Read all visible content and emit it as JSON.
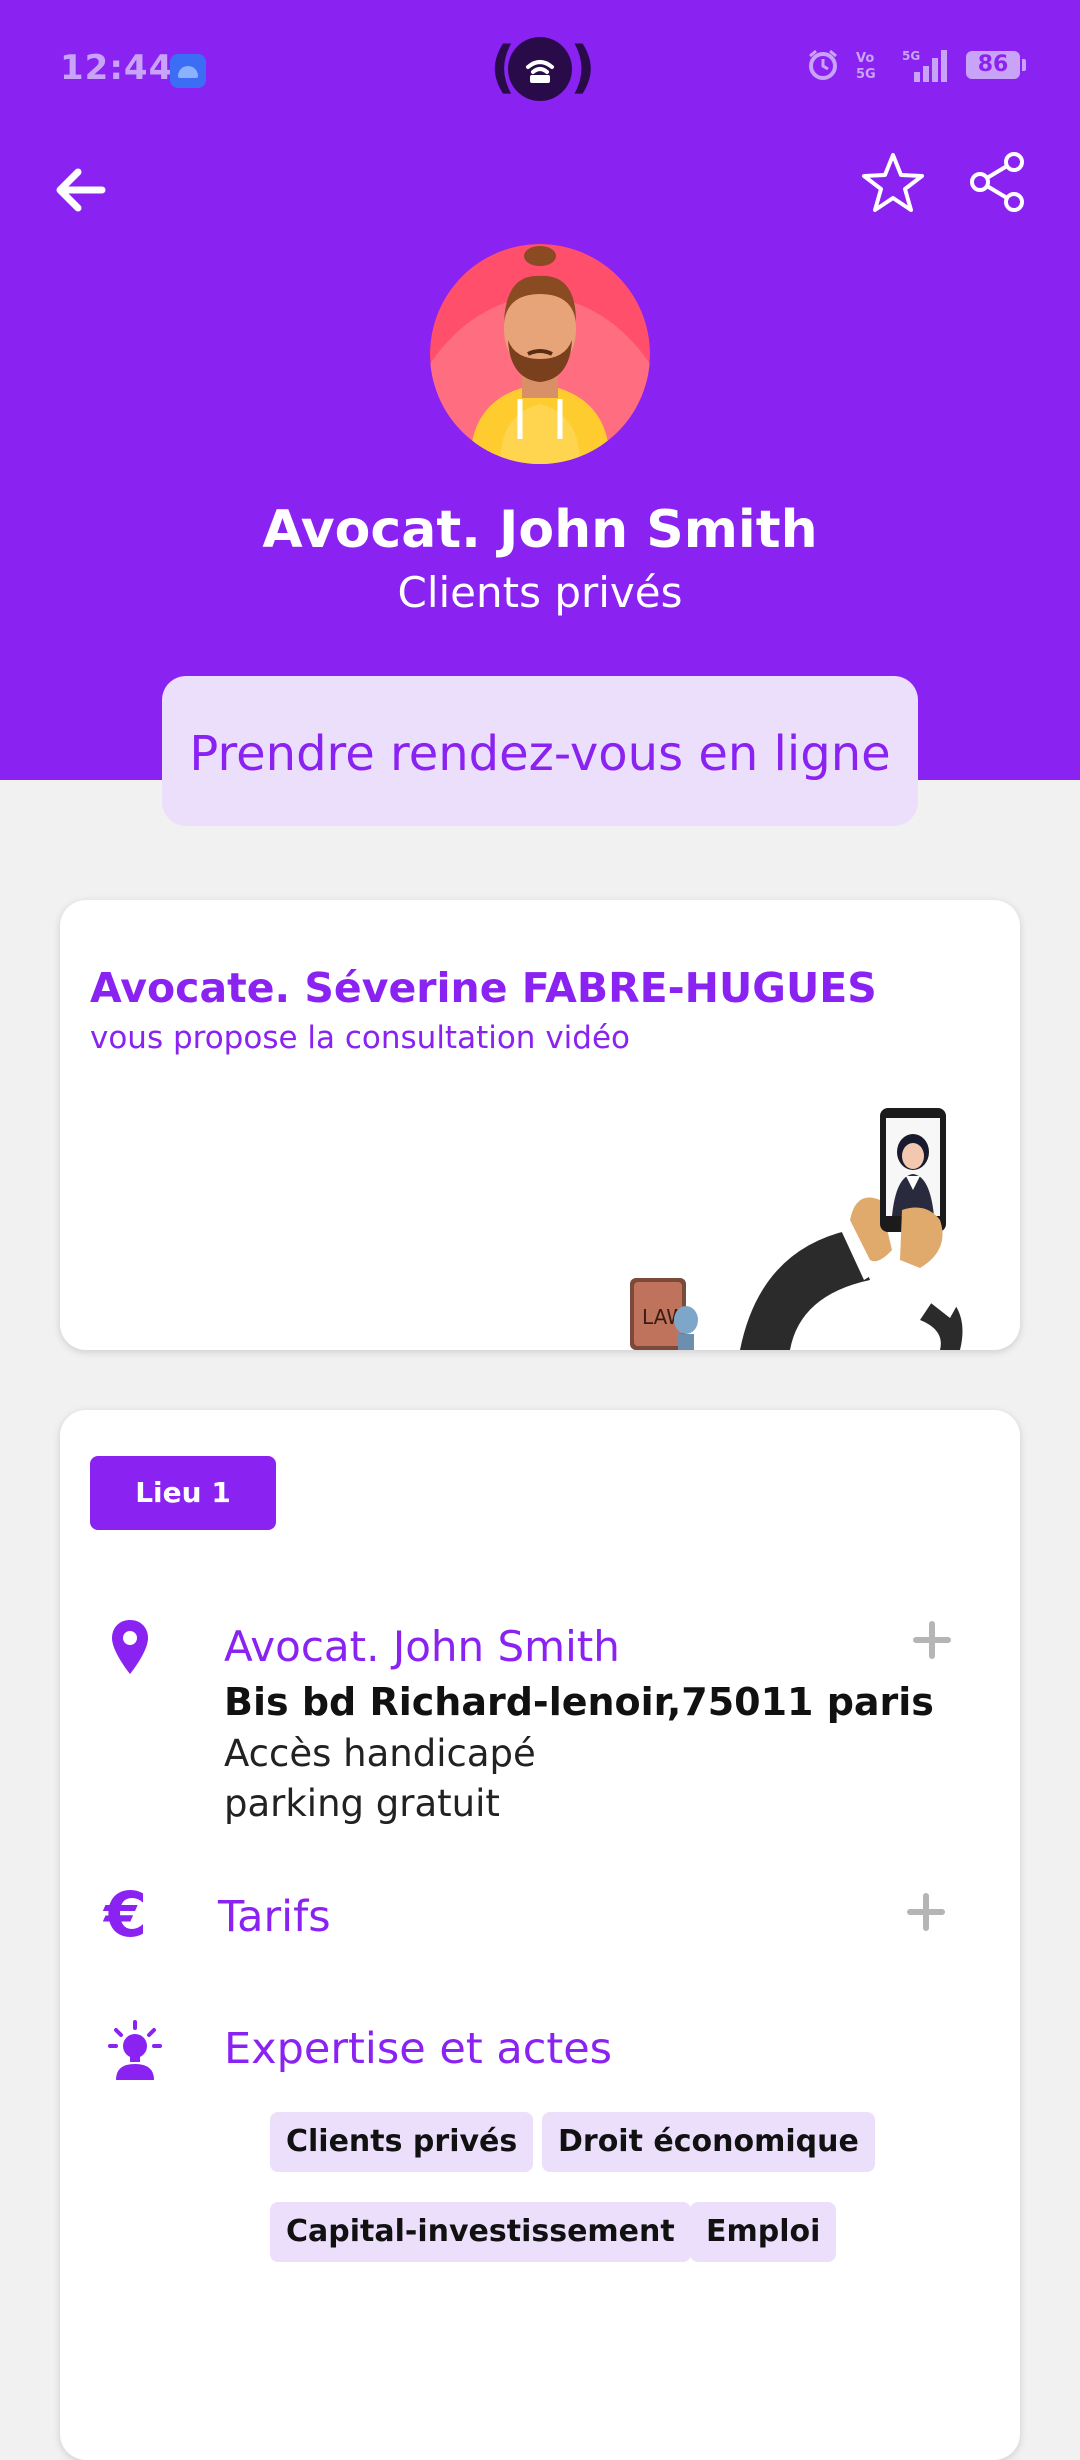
{
  "status_bar": {
    "time": "12:44",
    "battery": "86"
  },
  "header": {
    "back_icon": "arrow-left-icon",
    "favorite_icon": "star-outline-icon",
    "share_icon": "share-icon",
    "name": "Avocat. John Smith",
    "subtitle": "Clients privés",
    "cta_label": "Prendre rendez-vous en ligne"
  },
  "video_card": {
    "title": "Avocate. Séverine FABRE-HUGUES",
    "subtitle": "vous propose la consultation vidéo"
  },
  "info_card": {
    "location_tab": "Lieu 1",
    "location": {
      "name": "Avocat. John Smith",
      "address": "Bis bd Richard-lenoir,75011 paris",
      "lines": [
        "Accès handicapé",
        "parking gratuit"
      ]
    },
    "tarifs_label": "Tarifs",
    "expertise_label": "Expertise et actes",
    "tags": [
      "Clients privés",
      "Droit économique",
      "Capital-investissement",
      "Emploi"
    ]
  },
  "colors": {
    "primary": "#8a22f2",
    "light_primary": "#ecdffb",
    "background": "#f1f1f1"
  }
}
